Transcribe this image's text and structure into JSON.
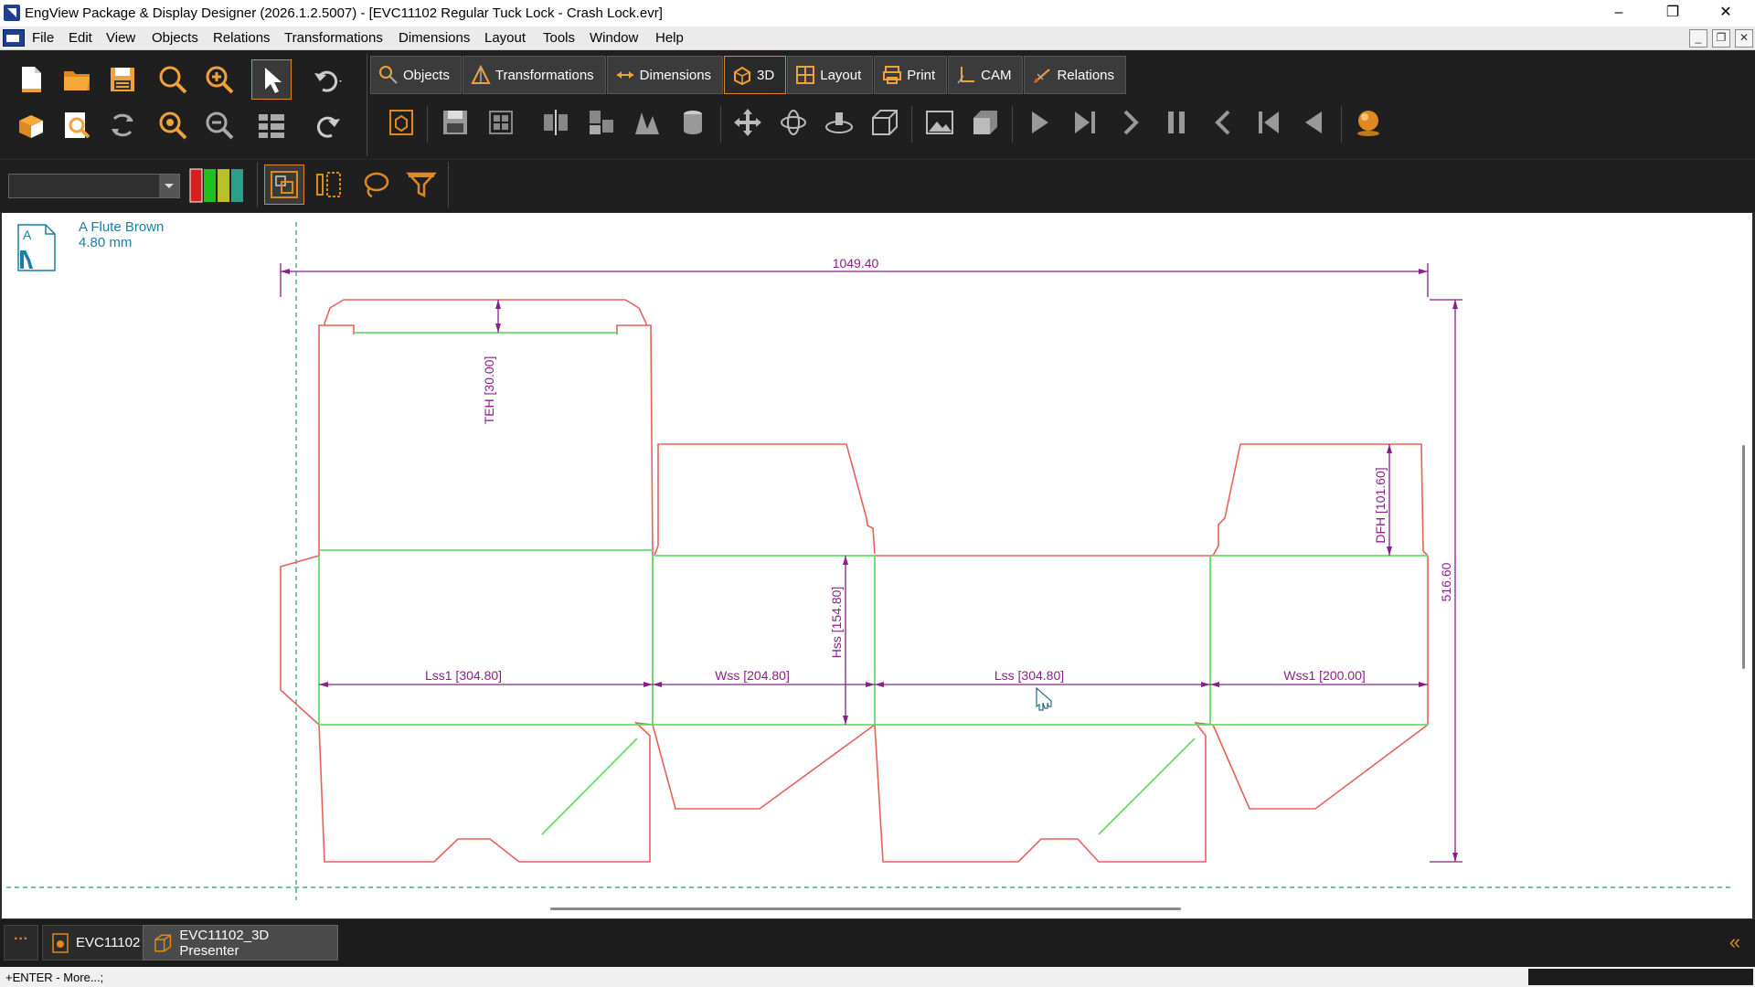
{
  "window": {
    "title": "EngView Package & Display Designer (2026.1.2.5007) - [EVC11102 Regular Tuck Lock - Crash Lock.evr]",
    "minimize": "–",
    "maximize": "❐",
    "close": "✕"
  },
  "menu": {
    "items": [
      "File",
      "Edit",
      "View",
      "Objects",
      "Relations",
      "Transformations",
      "Dimensions",
      "Layout",
      "Tools",
      "Window",
      "Help"
    ]
  },
  "ribbon_tabs": [
    {
      "label": "Objects",
      "icon": "objects-icon"
    },
    {
      "label": "Transformations",
      "icon": "transformations-icon"
    },
    {
      "label": "Dimensions",
      "icon": "dimensions-icon"
    },
    {
      "label": "3D",
      "icon": "3d-icon",
      "active": true
    },
    {
      "label": "Layout",
      "icon": "layout-icon"
    },
    {
      "label": "Print",
      "icon": "print-icon"
    },
    {
      "label": "CAM",
      "icon": "cam-icon"
    },
    {
      "label": "Relations",
      "icon": "relations-icon"
    }
  ],
  "material": {
    "name": "A Flute Brown",
    "thickness": "4.80 mm",
    "icon_letter": "A"
  },
  "drawing": {
    "dims": {
      "overall_width": "1049.40",
      "overall_height": "516.60",
      "teh": "TEH [30.00]",
      "dfh": "DFH [101.60]",
      "hss": "Hss [154.80]",
      "lss1": "Lss1 [304.80]",
      "wss": "Wss [204.80]",
      "lss": "Lss [304.80]",
      "wss1": "Wss1 [200.00]"
    },
    "colors": {
      "cut": "#e8605a",
      "crease": "#63e063",
      "dimension": "#8a1f8a",
      "guide": "#2f9a6a"
    }
  },
  "doc_tabs": {
    "more": "···",
    "tab1": "EVC11102",
    "tab2": "EVC11102_3D Presenter",
    "collapse": "«"
  },
  "status": {
    "text": "+ENTER - More...;"
  }
}
